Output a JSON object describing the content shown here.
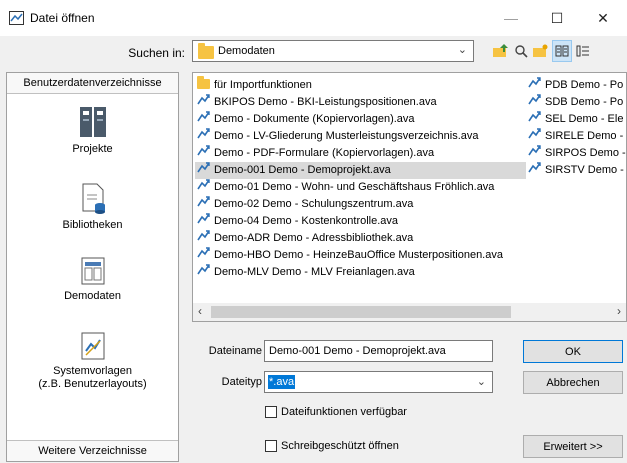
{
  "window": {
    "title": "Datei öffnen",
    "minimize": "—",
    "maximize": "☐",
    "close": "✕"
  },
  "search": {
    "label": "Suchen in:",
    "folder": "Demodaten"
  },
  "left_panel": {
    "header": "Benutzerdatenverzeichnisse",
    "places": [
      {
        "label": "Projekte",
        "icon": "projects-icon"
      },
      {
        "label": "Bibliotheken",
        "icon": "library-icon"
      },
      {
        "label": "Demodaten",
        "icon": "demodata-icon"
      },
      {
        "label": "Systemvorlagen\n(z.B. Benutzerlayouts)",
        "icon": "system-templates-icon"
      }
    ],
    "footer": "Weitere Verzeichnisse"
  },
  "files": {
    "column1": [
      {
        "name": "für Importfunktionen",
        "type": "folder"
      },
      {
        "name": "BKIPOS Demo - BKI-Leistungspositionen.ava",
        "type": "ava"
      },
      {
        "name": "Demo - Dokumente (Kopiervorlagen).ava",
        "type": "ava"
      },
      {
        "name": "Demo - LV-Gliederung Musterleistungsverzeichnis.ava",
        "type": "ava"
      },
      {
        "name": "Demo - PDF-Formulare (Kopiervorlagen).ava",
        "type": "ava"
      },
      {
        "name": "Demo-001 Demo - Demoprojekt.ava",
        "type": "ava",
        "selected": true
      },
      {
        "name": "Demo-01 Demo - Wohn- und Geschäftshaus Fröhlich.ava",
        "type": "ava"
      },
      {
        "name": "Demo-02 Demo - Schulungszentrum.ava",
        "type": "ava"
      },
      {
        "name": "Demo-04 Demo - Kostenkontrolle.ava",
        "type": "ava"
      },
      {
        "name": "Demo-ADR Demo - Adressbibliothek.ava",
        "type": "ava"
      },
      {
        "name": "Demo-HBO Demo - HeinzeBauOffice Musterpositionen.ava",
        "type": "ava"
      },
      {
        "name": "Demo-MLV Demo - MLV Freianlagen.ava",
        "type": "ava"
      }
    ],
    "column2": [
      {
        "name": "PDB Demo - Po",
        "type": "ava"
      },
      {
        "name": "SDB Demo - Po",
        "type": "ava"
      },
      {
        "name": "SEL Demo - Ele",
        "type": "ava"
      },
      {
        "name": "SIRELE Demo -",
        "type": "ava"
      },
      {
        "name": "SIRPOS Demo -",
        "type": "ava"
      },
      {
        "name": "SIRSTV Demo -",
        "type": "ava"
      }
    ]
  },
  "form": {
    "filename_label": "Dateiname",
    "filename_value": "Demo-001 Demo - Demoprojekt.ava",
    "filetype_label": "Dateityp",
    "filetype_value": "*.ava",
    "check_functions": "Dateifunktionen verfügbar",
    "check_readonly": "Schreibgeschützt öffnen",
    "ok": "OK",
    "cancel": "Abbrechen",
    "extended": "Erweitert >>"
  },
  "colors": {
    "selection": "#d9d9d9",
    "highlight": "#0078d7",
    "folder": "#f6c342"
  }
}
